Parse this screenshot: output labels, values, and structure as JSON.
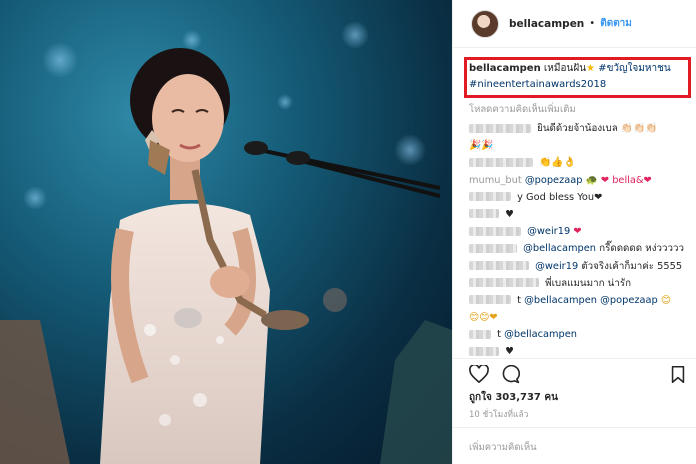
{
  "post": {
    "username": "bellacampen",
    "separator": "•",
    "follow_label": "ติดตาม"
  },
  "caption": {
    "username": "bellacampen",
    "text": "เหมือนฝัน",
    "hashtag1": "#ขวัญใจมหาชน",
    "hashtag2": "#nineentertainawards2018"
  },
  "load_more_label": "โหลดความคิดเห็นเพิ่มเติม",
  "comments": [
    {
      "prefix": "",
      "mention": "",
      "text": "ยินดีด้วยจ้าน้องเบล 👏🏻👏🏻👏🏻",
      "suffix": ""
    },
    {
      "prefix": "",
      "mention": "",
      "text": "🎉🎉",
      "suffix": ""
    },
    {
      "prefix": "",
      "mention": "",
      "text": "👏👍👌",
      "suffix": ""
    },
    {
      "prefix": "mumu_but",
      "mention": "@popezaap",
      "text": "🐢",
      "suffix": "❤ bella&❤"
    },
    {
      "prefix": "",
      "mention": "",
      "text": "y God bless You❤",
      "suffix": ""
    },
    {
      "prefix": "",
      "mention": "",
      "text": "♥",
      "suffix": ""
    },
    {
      "prefix": "",
      "mention": "@weir19",
      "text": "",
      "suffix": "❤"
    },
    {
      "prefix": "",
      "mention": "@bellacampen",
      "text": "กรี๊ดดดดด หง่ววววว",
      "suffix": ""
    },
    {
      "prefix": "",
      "mention": "@weir19",
      "text": "ตัวจริงเค้าก็มาค่ะ 5555",
      "suffix": ""
    },
    {
      "prefix": "",
      "mention": "",
      "text": "พี่เบลแมนมาก น่ารัก",
      "suffix": ""
    },
    {
      "prefix": "t",
      "mention": "@bellacampen @popezaap",
      "text": "😊",
      "suffix": ""
    },
    {
      "prefix": "",
      "mention": "",
      "text": "😊😊❤",
      "suffix": ""
    },
    {
      "prefix": "t",
      "mention": "@bellacampen",
      "text": "",
      "suffix": ""
    },
    {
      "prefix": "",
      "mention": "",
      "text": "♥",
      "suffix": ""
    }
  ],
  "likes": {
    "label": "ถูกใจ",
    "count": "303,737",
    "unit": "คน"
  },
  "time_ago": "10 ชั่วโมงที่แล้ว",
  "add_comment_placeholder": "เพิ่มความคิดเห็น",
  "icons": [
    "heart-icon",
    "comment-icon",
    "bookmark-icon",
    "star-icon"
  ],
  "colors": {
    "link": "#003569",
    "follow": "#3897f0",
    "highlight_box": "#e01b24",
    "heart": "#e0245e"
  }
}
